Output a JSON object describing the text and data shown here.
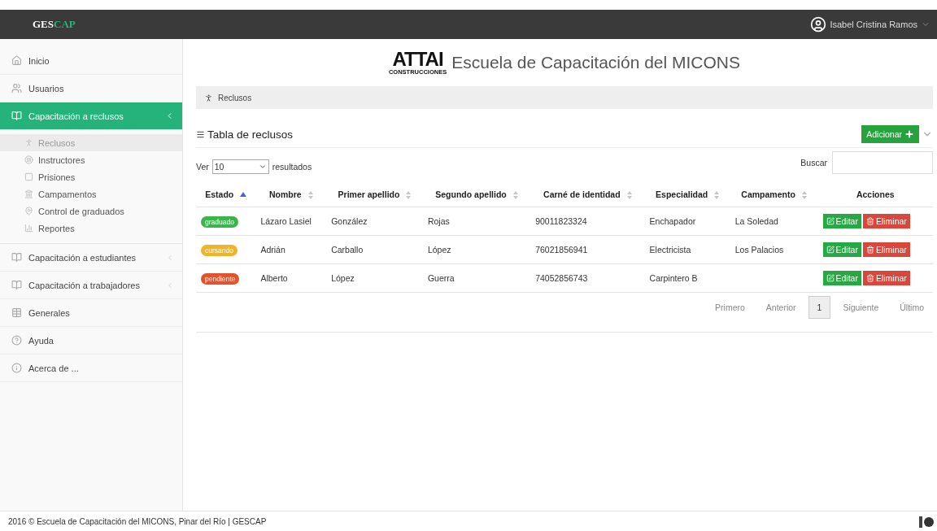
{
  "header": {
    "brand": {
      "first": "GES",
      "second": "CAP"
    },
    "user": "Isabel Cristina Ramos"
  },
  "sidebar": {
    "items": [
      {
        "label": "Inicio",
        "selected": false
      },
      {
        "label": "Usuarios",
        "selected": false
      },
      {
        "label": "Capacitación a reclusos",
        "selected": true,
        "expanded": true,
        "children": [
          {
            "label": "Reclusos",
            "selected": true
          },
          {
            "label": "Instructores",
            "selected": false
          },
          {
            "label": "Prisiones",
            "selected": false
          },
          {
            "label": "Campamentos",
            "selected": false
          },
          {
            "label": "Control de graduados",
            "selected": false
          },
          {
            "label": "Reportes",
            "selected": false
          }
        ]
      },
      {
        "label": "Capacitación a estudiantes",
        "selected": false,
        "expanded": false
      },
      {
        "label": "Capacitación a trabajadores",
        "selected": false,
        "expanded": false
      },
      {
        "label": "Generales",
        "selected": false
      },
      {
        "label": "Ayuda",
        "selected": false
      },
      {
        "label": "Acerca de ...",
        "selected": false
      }
    ]
  },
  "title": {
    "logo": "ATTAI",
    "logo_sub": "CONSTRUCCIONES",
    "text": "Escuela de Capacitación del MICONS"
  },
  "breadcrumb": "Reclusos",
  "panel": {
    "title": "Tabla de reclusos",
    "add_button": "Adicionar",
    "length": {
      "before": "Ver",
      "value": "10",
      "after": "resultados"
    },
    "search": {
      "label": "Buscar"
    },
    "columns": [
      {
        "label": "Estado",
        "sorted": true
      },
      {
        "label": "Nombre",
        "sorted": false
      },
      {
        "label": "Primer apellido",
        "sorted": false
      },
      {
        "label": "Segundo apellido",
        "sorted": false
      },
      {
        "label": "Carné de identidad",
        "sorted": false
      },
      {
        "label": "Especialidad",
        "sorted": false
      },
      {
        "label": "Campamento",
        "sorted": false
      },
      {
        "label": "Acciones"
      }
    ],
    "rows": [
      {
        "estado": "graduado",
        "color": "#3cb44b",
        "nombre": "Lázaro Lasiel",
        "primer_apellido": "González",
        "segundo_apellido": "Rojas",
        "carne": "90011823324",
        "especialidad": "Enchapador",
        "campamento": "La Soledad",
        "edit": "Editar",
        "delete": "Eliminar"
      },
      {
        "estado": "cursando",
        "color": "#f0b429",
        "nombre": "Adrián",
        "primer_apellido": "Carballo",
        "segundo_apellido": "López",
        "carne": "76021856941",
        "especialidad": "Electricista",
        "campamento": "Los Palacios",
        "edit": "Editar",
        "delete": "Eliminar"
      },
      {
        "estado": "pendiente",
        "color": "#e2522e",
        "nombre": "Alberto",
        "primer_apellido": "López",
        "segundo_apellido": "Guerra",
        "carne": "74052856743",
        "especialidad": "Carpintero B",
        "edit": "Editar",
        "delete": "Eliminar"
      }
    ],
    "pagination": [
      {
        "label": "Primero",
        "selected": false
      },
      {
        "label": "Anterior",
        "selected": false
      },
      {
        "label": "1",
        "selected": true
      },
      {
        "label": "Siguiente",
        "selected": false
      },
      {
        "label": "Último",
        "selected": false
      }
    ]
  },
  "footer": "2016 © Escuela de Capacitación del MICONS, Pinar del Río | GESCAP"
}
